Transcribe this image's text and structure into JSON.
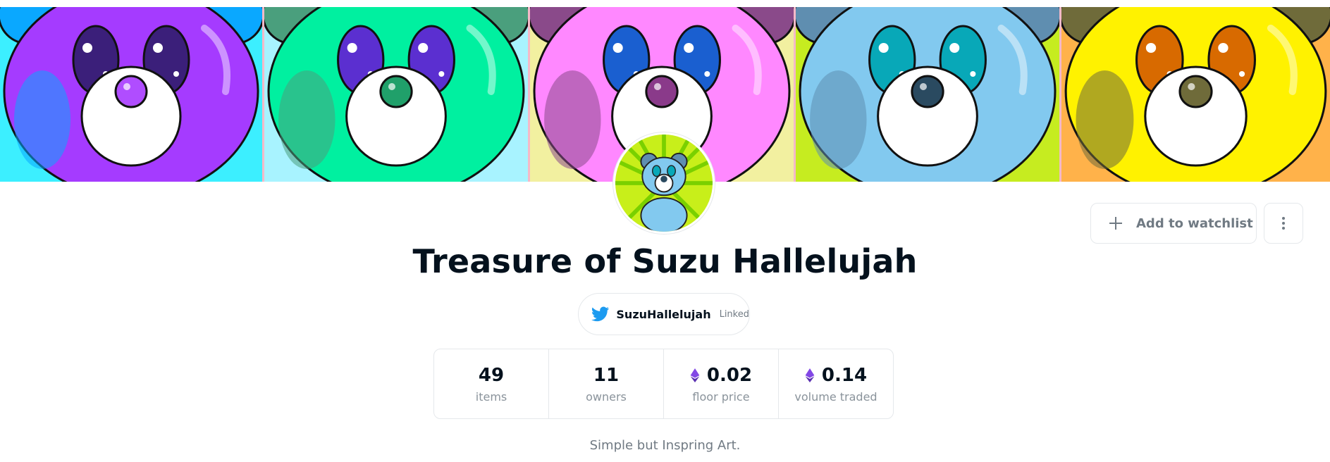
{
  "collection": {
    "title": "Treasure of Suzu Hallelujah",
    "description": "Simple but Inspring Art."
  },
  "banner": {
    "panels": [
      {
        "body": "#a53bff",
        "body2": "#0aa8ff",
        "bg": "#3cefff",
        "eye": "#3b1f7a",
        "nose": "#b04dff"
      },
      {
        "body": "#00f0a0",
        "body2": "#4a9f7d",
        "bg": "#a8f3ff",
        "eye": "#5b2fd0",
        "nose": "#20a06a"
      },
      {
        "body": "#ff88ff",
        "body2": "#8a4a8a",
        "bg": "#f2f0a0",
        "eye": "#1a5fd0",
        "nose": "#8a3a8a"
      },
      {
        "body": "#82c9ef",
        "body2": "#5f8eb0",
        "bg": "#c6ec20",
        "eye": "#08a8b8",
        "nose": "#2a4a60"
      },
      {
        "body": "#fff200",
        "body2": "#6f6b3a",
        "bg": "#ffb24a",
        "eye": "#d86a00",
        "nose": "#6f6b3a"
      }
    ]
  },
  "actions": {
    "watchlist_label": "Add to watchlist"
  },
  "social": {
    "twitter_handle": "SuzuHallelujah",
    "linked_label": "Linked",
    "twitter_color": "#1d9bf0"
  },
  "stats": [
    {
      "value": "49",
      "label": "items",
      "eth": false
    },
    {
      "value": "11",
      "label": "owners",
      "eth": false
    },
    {
      "value": "0.02",
      "label": "floor price",
      "eth": true
    },
    {
      "value": "0.14",
      "label": "volume traded",
      "eth": true
    }
  ],
  "icons": {
    "twitter": "twitter-icon",
    "plus": "plus-icon",
    "more": "more-vertical-icon",
    "eth": "ethereum-icon"
  }
}
